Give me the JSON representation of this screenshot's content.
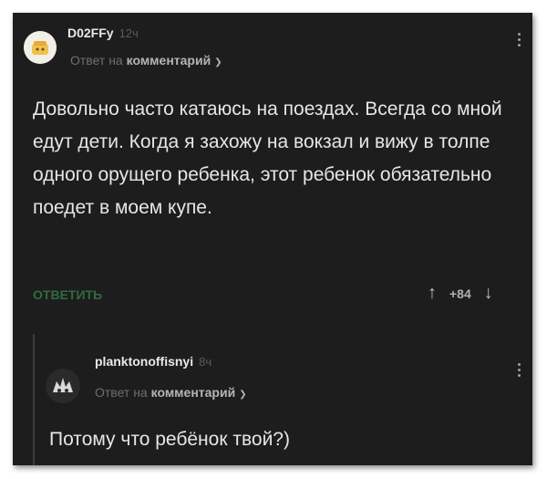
{
  "comment": {
    "username": "D02FFy",
    "time": "12ч",
    "reply_prefix": "Ответ на",
    "reply_target": "комментарий",
    "text": "Довольно часто катаюсь на поездах. Всегда со мной едут дети. Когда я захожу на вокзал и вижу в толпе одного орущего ребенка, этот ребенок обязательно поедет в моем купе.",
    "reply_label": "ОТВЕТИТЬ",
    "rating": "+84"
  },
  "reply": {
    "username": "planktonoffisnyi",
    "time": "8ч",
    "reply_prefix": "Ответ на",
    "reply_target": "комментарий",
    "text": "Потому что ребёнок твой?)"
  },
  "colors": {
    "background": "#1d1d1d",
    "reply_button": "#2f6b42",
    "text": "#e6e6e6"
  },
  "icons": [
    "avatar",
    "chevron-down-icon",
    "more-vertical-icon",
    "upvote-arrow-icon",
    "downvote-arrow-icon"
  ]
}
